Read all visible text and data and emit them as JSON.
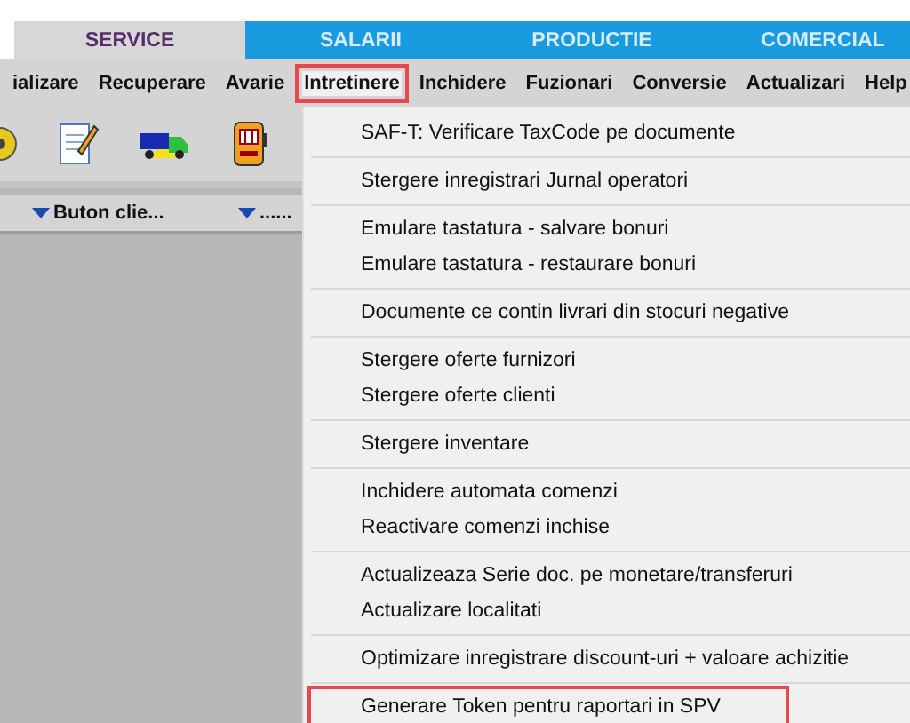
{
  "tabs": [
    {
      "label": "SERVICE",
      "selected": true
    },
    {
      "label": "SALARII",
      "selected": false
    },
    {
      "label": "PRODUCTIE",
      "selected": false
    },
    {
      "label": "COMERCIAL",
      "selected": false
    }
  ],
  "menubar": [
    {
      "label": "ializare",
      "selected": false,
      "highlighted": false
    },
    {
      "label": "Recuperare",
      "selected": false,
      "highlighted": false
    },
    {
      "label": "Avarie",
      "selected": false,
      "highlighted": false
    },
    {
      "label": "Intretinere",
      "selected": true,
      "highlighted": true
    },
    {
      "label": "Inchidere",
      "selected": false,
      "highlighted": false
    },
    {
      "label": "Fuzionari",
      "selected": false,
      "highlighted": false
    },
    {
      "label": "Conversie",
      "selected": false,
      "highlighted": false
    },
    {
      "label": "Actualizari",
      "selected": false,
      "highlighted": false
    },
    {
      "label": "Help",
      "selected": false,
      "highlighted": false
    }
  ],
  "toolbar": [
    {
      "kind": "disc"
    },
    {
      "kind": "notepad"
    },
    {
      "kind": "truck"
    },
    {
      "kind": "slot"
    }
  ],
  "columns": [
    "Buton clie...",
    "......"
  ],
  "menu": [
    [
      {
        "label": "SAF-T: Verificare TaxCode pe documente",
        "highlighted": false
      }
    ],
    [
      {
        "label": "Stergere inregistrari Jurnal operatori",
        "highlighted": false
      }
    ],
    [
      {
        "label": "Emulare tastatura - salvare bonuri",
        "highlighted": false
      },
      {
        "label": "Emulare tastatura - restaurare bonuri",
        "highlighted": false
      }
    ],
    [
      {
        "label": "Documente ce contin livrari din stocuri negative",
        "highlighted": false
      }
    ],
    [
      {
        "label": "Stergere oferte furnizori",
        "highlighted": false
      },
      {
        "label": "Stergere oferte clienti",
        "highlighted": false
      }
    ],
    [
      {
        "label": "Stergere inventare",
        "highlighted": false
      }
    ],
    [
      {
        "label": "Inchidere automata comenzi",
        "highlighted": false
      },
      {
        "label": "Reactivare comenzi inchise",
        "highlighted": false
      }
    ],
    [
      {
        "label": "Actualizeaza Serie doc. pe monetare/transferuri",
        "highlighted": false
      },
      {
        "label": "Actualizare localitati",
        "highlighted": false
      }
    ],
    [
      {
        "label": "Optimizare inregistrare discount-uri + valoare achizitie",
        "highlighted": false
      }
    ],
    [
      {
        "label": "Generare Token pentru raportari in SPV",
        "highlighted": true
      }
    ]
  ]
}
